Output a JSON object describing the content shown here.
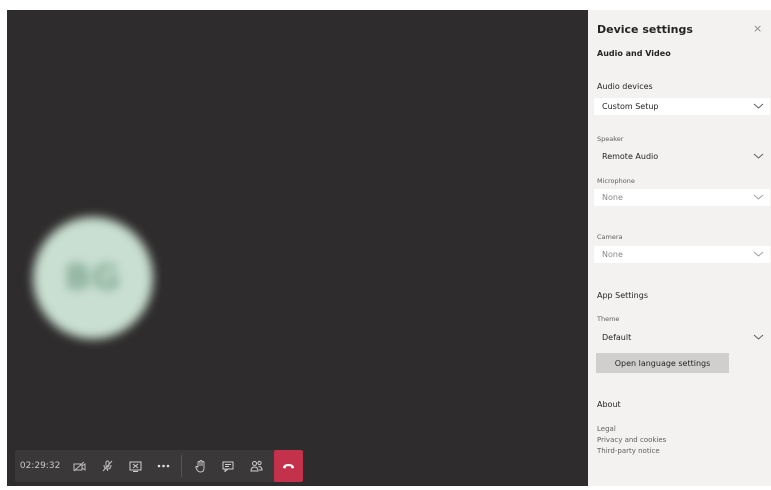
{
  "call": {
    "timer": "02:29:32",
    "avatar_initials": "BG",
    "colors": {
      "stage": "#2e2c2c",
      "toolbar": "#3a3838",
      "hangup": "#c4314b"
    },
    "toolbar_icons": [
      "camera-off-icon",
      "mic-off-icon",
      "share-screen-icon",
      "more-icon",
      "raise-hand-icon",
      "chat-icon",
      "participants-icon",
      "hang-up-icon"
    ]
  },
  "panel": {
    "title": "Device settings",
    "close": "×",
    "subtitle": "Audio and Video",
    "audio_devices": {
      "label": "Audio devices",
      "value": "Custom Setup"
    },
    "speaker": {
      "label": "Speaker",
      "value": "Remote Audio"
    },
    "microphone": {
      "label": "Microphone",
      "value": "None"
    },
    "camera": {
      "label": "Camera",
      "value": "None"
    },
    "app_settings": {
      "heading": "App Settings",
      "theme_label": "Theme",
      "theme_value": "Default",
      "language_button": "Open language settings"
    },
    "about": {
      "heading": "About",
      "links": [
        "Legal",
        "Privacy and cookies",
        "Third-party notice"
      ]
    }
  }
}
